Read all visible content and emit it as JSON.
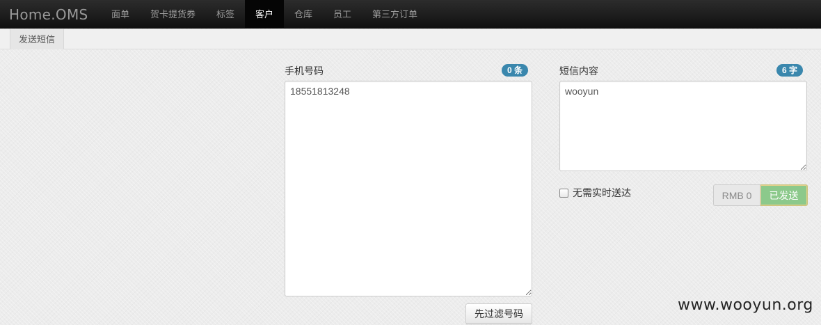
{
  "navbar": {
    "brand": "Home.OMS",
    "items": [
      {
        "label": "面单"
      },
      {
        "label": "贺卡提货券"
      },
      {
        "label": "标签"
      },
      {
        "label": "客户",
        "active": true
      },
      {
        "label": "仓库"
      },
      {
        "label": "员工"
      },
      {
        "label": "第三方订单"
      }
    ]
  },
  "subnav": {
    "items": [
      {
        "label": "发送短信"
      }
    ]
  },
  "phone_panel": {
    "label": "手机号码",
    "count_badge": "0 条",
    "value": "18551813248",
    "filter_button": "先过滤号码"
  },
  "sms_panel": {
    "label": "短信内容",
    "count_badge": "6 字",
    "value": "wooyun",
    "checkbox_label": "无需实时送达",
    "checkbox_checked": false,
    "price_button": "RMB 0",
    "sent_button": "已发送"
  },
  "watermark": "www.wooyun.org",
  "colors": {
    "navbar_bg": "#1b1b1b",
    "active_nav_bg": "#050505",
    "badge_bg": "#3a87ad",
    "sent_button_bg": "#8cc98b"
  }
}
